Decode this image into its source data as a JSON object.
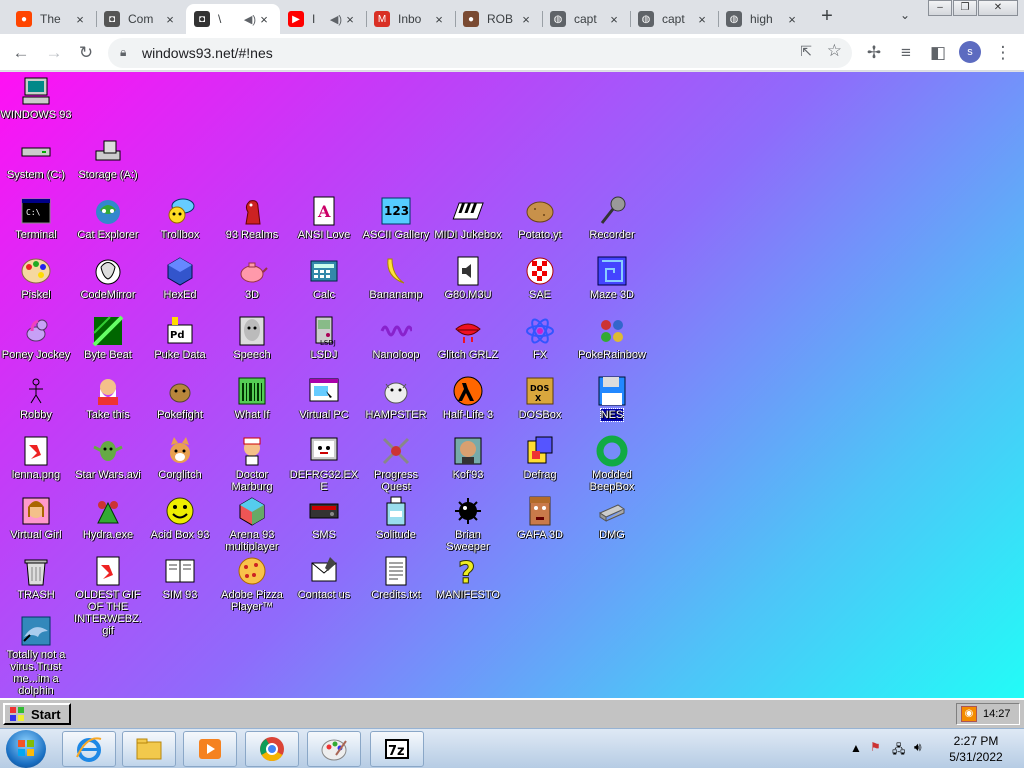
{
  "browser": {
    "tabs": [
      {
        "title": "The",
        "icon": "reddit-icon",
        "color": "#ff4500"
      },
      {
        "title": "Com",
        "icon": "windows93-icon",
        "color": "#555555"
      },
      {
        "title": "\\",
        "icon": "windows93-icon",
        "color": "#333333",
        "active": true
      },
      {
        "title": "I",
        "icon": "youtube-icon",
        "color": "#ff0000"
      },
      {
        "title": "Inbo",
        "icon": "gmail-icon",
        "color": "#d93025"
      },
      {
        "title": "ROB",
        "icon": "avatar-icon",
        "color": "#7a4a32"
      },
      {
        "title": "capt",
        "icon": "globe-icon",
        "color": "#5f6368"
      },
      {
        "title": "capt",
        "icon": "globe-icon",
        "color": "#5f6368"
      },
      {
        "title": "high",
        "icon": "globe-icon",
        "color": "#5f6368"
      }
    ],
    "url": "windows93.net/#!nes",
    "profile_initial": "s"
  },
  "desktop": {
    "icons": [
      {
        "label": "WINDOWS 93",
        "icon": "computer-icon"
      },
      {
        "label": "System (C:)",
        "icon": "drive-icon"
      },
      {
        "label": "Storage (A:)",
        "icon": "floppy-drive-icon"
      },
      {
        "label": "Terminal",
        "icon": "terminal-icon"
      },
      {
        "label": "Cat Explorer",
        "icon": "cat-globe-icon"
      },
      {
        "label": "Trollbox",
        "icon": "chat-icon"
      },
      {
        "label": "93 Realms",
        "icon": "knight-icon"
      },
      {
        "label": "ANSI Love",
        "icon": "ansi-icon"
      },
      {
        "label": "ASCII Gallery",
        "icon": "ascii-icon"
      },
      {
        "label": "MIDI Jukebox",
        "icon": "piano-icon"
      },
      {
        "label": "Potato.yt",
        "icon": "potato-icon"
      },
      {
        "label": "Recorder",
        "icon": "microphone-icon"
      },
      {
        "label": "Piskel",
        "icon": "palette-icon"
      },
      {
        "label": "CodeMirror",
        "icon": "codemirror-icon"
      },
      {
        "label": "HexEd",
        "icon": "cube-icon"
      },
      {
        "label": "3D",
        "icon": "teapot-icon"
      },
      {
        "label": "Calc",
        "icon": "calculator-icon"
      },
      {
        "label": "Bananamp",
        "icon": "banana-icon"
      },
      {
        "label": "G80.M3U",
        "icon": "audio-file-icon"
      },
      {
        "label": "SAE",
        "icon": "amiga-ball-icon"
      },
      {
        "label": "Maze 3D",
        "icon": "maze-icon"
      },
      {
        "label": "Poney Jockey",
        "icon": "pony-icon"
      },
      {
        "label": "Byte Beat",
        "icon": "bytebeat-icon"
      },
      {
        "label": "Puke Data",
        "icon": "pukedata-icon"
      },
      {
        "label": "Speech",
        "icon": "face-icon"
      },
      {
        "label": "LSDJ",
        "icon": "gameboy-icon"
      },
      {
        "label": "Nanoloop",
        "icon": "waveform-icon"
      },
      {
        "label": "Glitch GRLZ",
        "icon": "lips-icon"
      },
      {
        "label": "FX",
        "icon": "atom-icon"
      },
      {
        "label": "PokeRainbow",
        "icon": "pokemon-trainers-icon"
      },
      {
        "label": "Robby",
        "icon": "stickman-icon"
      },
      {
        "label": "Take this",
        "icon": "old-man-icon"
      },
      {
        "label": "Pokefight",
        "icon": "pokemon-icon"
      },
      {
        "label": "What If",
        "icon": "barcode-icon"
      },
      {
        "label": "Virtual PC",
        "icon": "virtual-pc-icon"
      },
      {
        "label": "HAMPSTER",
        "icon": "hamster-icon"
      },
      {
        "label": "Half-Life 3",
        "icon": "half-life-icon"
      },
      {
        "label": "DOSBox",
        "icon": "dosbox-icon"
      },
      {
        "label": "NES",
        "icon": "floppy-icon",
        "selected": true
      },
      {
        "label": "lenna.png",
        "icon": "image-file-icon"
      },
      {
        "label": "Star Wars.avi",
        "icon": "yoda-icon"
      },
      {
        "label": "Corglitch",
        "icon": "corgi-icon"
      },
      {
        "label": "Doctor Marburg",
        "icon": "doctor-icon"
      },
      {
        "label": "DEFRG32.EXE",
        "icon": "defrag-monitor-icon"
      },
      {
        "label": "Progress Quest",
        "icon": "swords-icon"
      },
      {
        "label": "Kof'93",
        "icon": "fighter-icon"
      },
      {
        "label": "Defrag",
        "icon": "defrag-icon"
      },
      {
        "label": "Modded BeepBox",
        "icon": "ring-icon"
      },
      {
        "label": "Virtual Girl",
        "icon": "girl-icon"
      },
      {
        "label": "Hydra.exe",
        "icon": "hydra-icon"
      },
      {
        "label": "Acid Box 93",
        "icon": "smiley-icon"
      },
      {
        "label": "Arena 93 multiplayer",
        "icon": "arena-cube-icon"
      },
      {
        "label": "SMS",
        "icon": "console-icon"
      },
      {
        "label": "Solitude",
        "icon": "bottle-icon"
      },
      {
        "label": "Brian Sweeper",
        "icon": "mine-icon"
      },
      {
        "label": "GAFA 3D",
        "icon": "doom-face-icon"
      },
      {
        "label": "DMG",
        "icon": "dmg-icon"
      },
      {
        "label": "TRASH",
        "icon": "trash-icon"
      },
      {
        "label": "OLDEST GIF OF THE INTERWEBZ.gif",
        "icon": "image-file-icon"
      },
      {
        "label": "SIM 93",
        "icon": "book-icon"
      },
      {
        "label": "Adobe Pizza Player™",
        "icon": "pizza-icon"
      },
      {
        "label": "Contact us",
        "icon": "contact-icon"
      },
      {
        "label": "Credits.txt",
        "icon": "text-file-icon"
      },
      {
        "label": "MANIFESTO",
        "icon": "question-mark-icon"
      },
      {
        "label": "Totally not a virus.Trust me...im a dolphin",
        "icon": "dolphin-icon"
      }
    ]
  },
  "w93taskbar": {
    "start_label": "Start",
    "clock": "14:27"
  },
  "win7taskbar": {
    "apps": [
      {
        "name": "internet-explorer-icon"
      },
      {
        "name": "file-explorer-icon"
      },
      {
        "name": "media-player-icon"
      },
      {
        "name": "chrome-icon"
      },
      {
        "name": "paint-icon"
      },
      {
        "name": "7zip-icon"
      }
    ],
    "time": "2:27 PM",
    "date": "5/31/2022"
  }
}
